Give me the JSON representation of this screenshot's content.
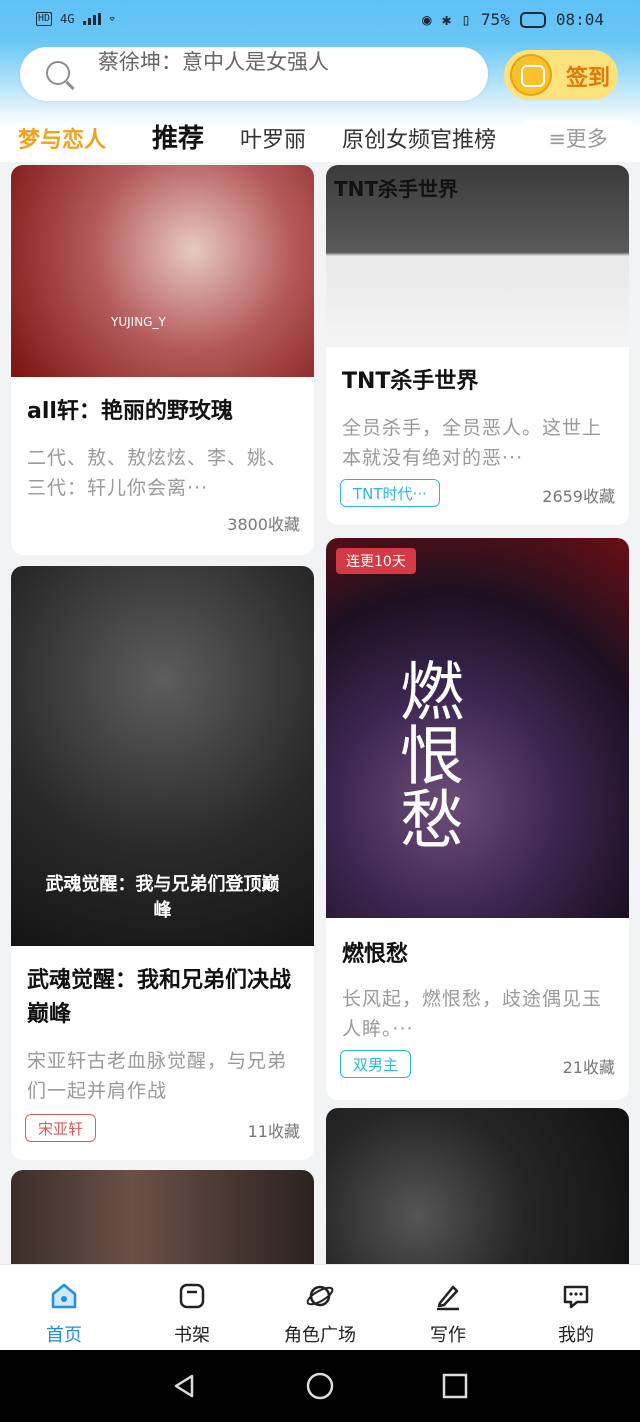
{
  "status": {
    "network": "4G",
    "battery": "75%",
    "time": "08:04",
    "hd": "HD"
  },
  "search": {
    "text": "蔡徐坤：意中人是女强人"
  },
  "signin": {
    "label": "签到"
  },
  "tabs": [
    "梦与恋人",
    "推荐",
    "叶罗丽",
    "原创女频官推榜"
  ],
  "more": "≡更多",
  "cards": [
    {
      "title": "all轩：艳丽的野玫瑰",
      "desc": "二代、敖、敖炫炫、李、姚、三代：轩儿你会离···",
      "fav": "3800收藏",
      "cover_text": "YUJING_Y"
    },
    {
      "title": "TNT杀手世界",
      "desc": "全员杀手，全员恶人。这世上本就没有绝对的恶···",
      "tag": "TNT时代···",
      "fav": "2659收藏",
      "cover_text": "TNT杀手世界"
    },
    {
      "title": "武魂觉醒：我和兄弟们决战巅峰",
      "desc": "宋亚轩古老血脉觉醒，与兄弟们一起并肩作战",
      "tag": "宋亚轩",
      "fav": "11收藏",
      "cover_text": "武魂觉醒：我与兄弟们登顶巅峰"
    },
    {
      "title": "燃恨愁",
      "desc": "长风起，燃恨愁，歧途偶见玉人眸。···",
      "tag": "双男主",
      "fav": "21收藏",
      "badge": "连更10天",
      "cover_text": "燃恨愁"
    }
  ],
  "nav": [
    {
      "label": "首页",
      "active": true
    },
    {
      "label": "书架"
    },
    {
      "label": "角色广场"
    },
    {
      "label": "写作"
    },
    {
      "label": "我的"
    }
  ],
  "colors": {
    "accent": "#1f8fe0",
    "tab_active": "#f1a11a",
    "tag_cyan": "#2cb9d8",
    "tag_red": "#e05a5a",
    "badge": "#d33a46"
  },
  "icons": [
    "search-icon",
    "sign-in-face-icon",
    "home-icon",
    "bookshelf-icon",
    "planet-icon",
    "pen-icon",
    "chat-icon",
    "back-icon",
    "home-circle-icon",
    "recents-icon"
  ]
}
